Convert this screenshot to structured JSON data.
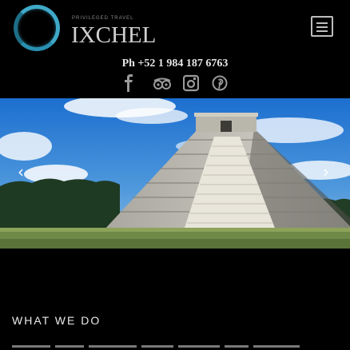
{
  "brand": {
    "tagline": "PRIVILEGED TRAVEL",
    "name": "IXCHEL"
  },
  "header": {
    "phone": "Ph +52 1 984 187 6763"
  },
  "social": [
    "facebook-icon",
    "tripadvisor-icon",
    "instagram-icon",
    "pinterest-icon"
  ],
  "hero": {
    "alt": "pyramid"
  },
  "nav": {
    "prev": "‹",
    "next": "›"
  },
  "section": {
    "title": "WHAT WE DO"
  },
  "colors": {
    "accent": "#3fa9c9",
    "background": "#000000"
  }
}
